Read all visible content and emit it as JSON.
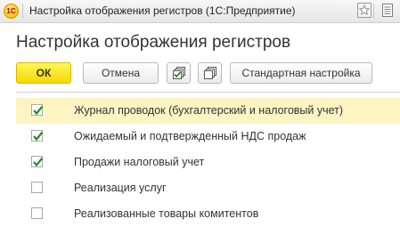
{
  "window": {
    "title": "Настройка отображения регистров  (1С:Предприятие)",
    "logo_text": "1С"
  },
  "header": {
    "title": "Настройка отображения регистров"
  },
  "toolbar": {
    "ok_label": "ОК",
    "cancel_label": "Отмена",
    "default_label": "Стандартная настройка",
    "icons": [
      "check-all-icon",
      "uncheck-all-icon"
    ]
  },
  "list": {
    "items": [
      {
        "label": "Журнал проводок (бухгалтерский и налоговый учет)",
        "checked": true,
        "selected": true
      },
      {
        "label": "Ожидаемый и подтвержденный НДС продаж",
        "checked": true,
        "selected": false
      },
      {
        "label": "Продажи налоговый учет",
        "checked": true,
        "selected": false
      },
      {
        "label": "Реализация услуг",
        "checked": false,
        "selected": false
      },
      {
        "label": "Реализованные товары комитентов",
        "checked": false,
        "selected": false
      }
    ]
  },
  "colors": {
    "accent": "#f5d900",
    "selected_row": "#fcf5c3",
    "check": "#2a8a2a"
  }
}
